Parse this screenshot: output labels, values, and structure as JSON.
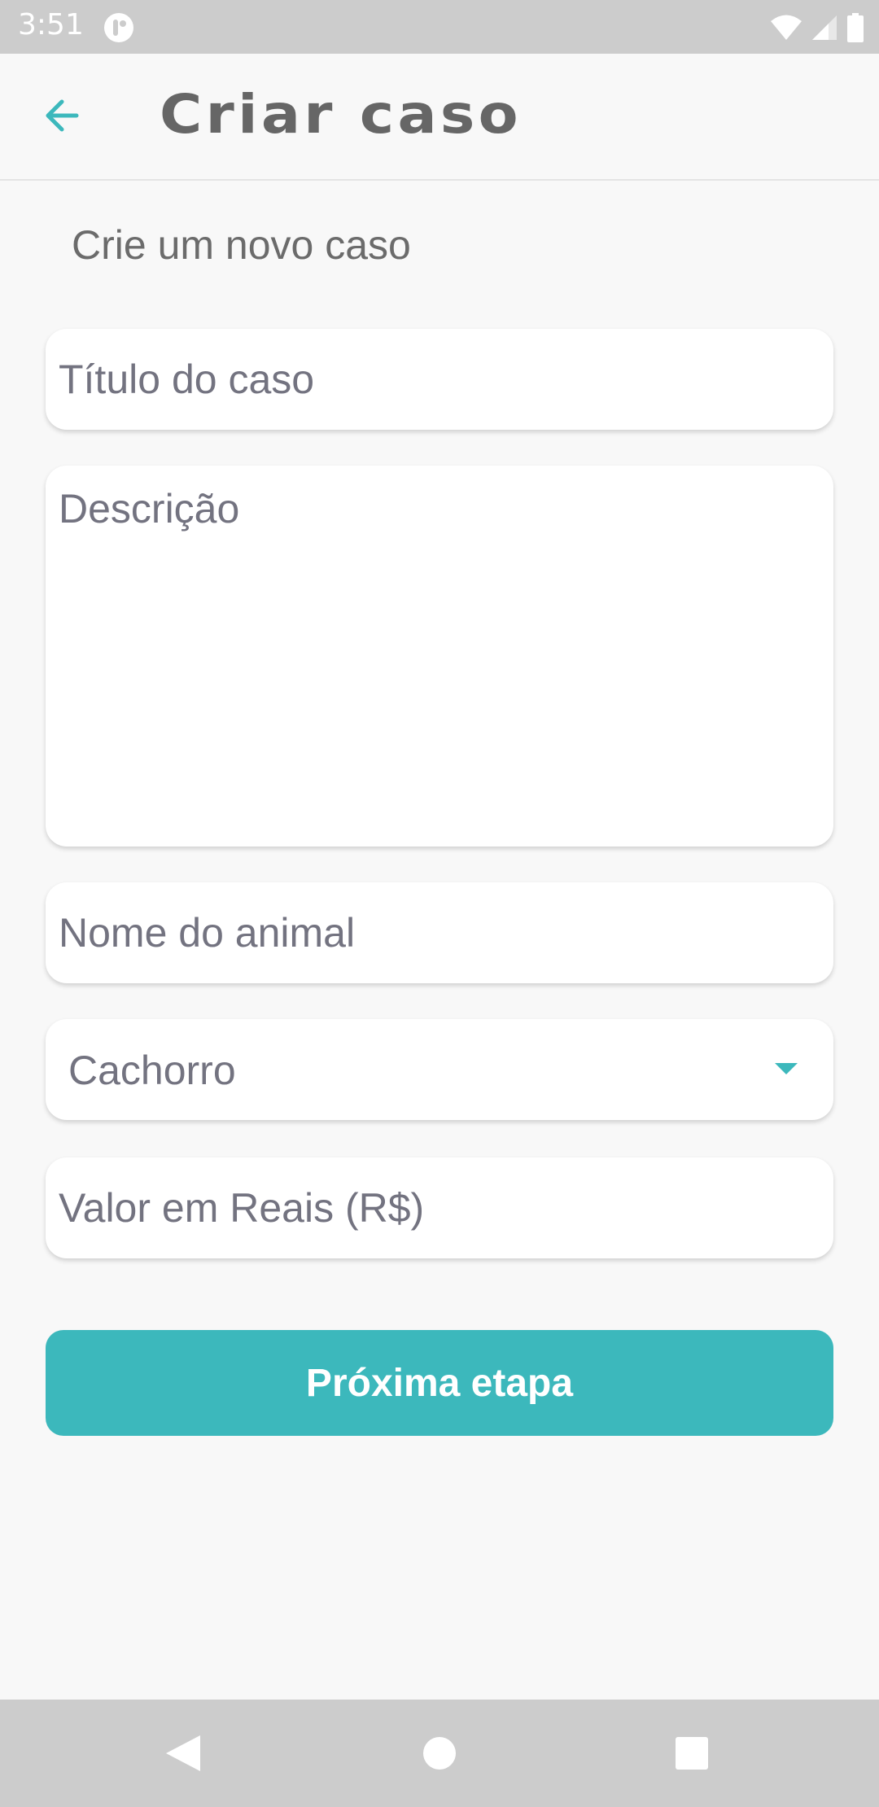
{
  "status_bar": {
    "time": "3:51",
    "icons": [
      "app-notification-icon",
      "wifi-icon",
      "cell-signal-icon",
      "battery-icon"
    ]
  },
  "app_bar": {
    "back_icon": "arrow-left-icon",
    "title": "Criar caso"
  },
  "form": {
    "subtitle": "Crie um novo caso",
    "title_placeholder": "Título do caso",
    "description_placeholder": "Descrição",
    "animal_name_placeholder": "Nome do animal",
    "species_selected": "Cachorro",
    "value_placeholder": "Valor em Reais (R$)",
    "next_button_label": "Próxima etapa"
  },
  "nav_bar": {
    "icons": [
      "nav-back-icon",
      "nav-home-icon",
      "nav-recents-icon"
    ]
  },
  "colors": {
    "accent": "#3cb8bc",
    "text_muted": "#737380",
    "title_text": "#666666",
    "background": "#f8f8f8"
  }
}
